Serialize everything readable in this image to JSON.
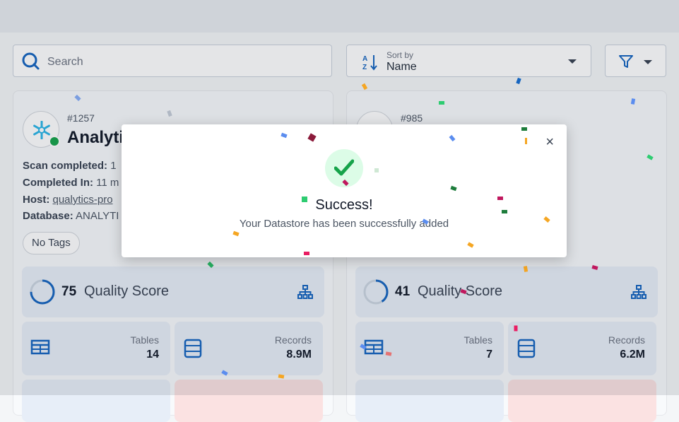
{
  "search": {
    "placeholder": "Search"
  },
  "sort": {
    "label": "Sort by",
    "value": "Name"
  },
  "cards": [
    {
      "id": "#1257",
      "name": "Analytics",
      "meta": [
        {
          "key": "Scan completed:",
          "value": "1"
        },
        {
          "key": "Completed In:",
          "value": "11 m"
        },
        {
          "key": "Host:",
          "value": "qualytics-pro"
        },
        {
          "key": "Database:",
          "value": "ANALYTI"
        }
      ],
      "tag": "No Tags",
      "quality_score": "75",
      "quality_fraction": 0.75,
      "quality_label": "Quality Score",
      "tables_label": "Tables",
      "tables_value": "14",
      "records_label": "Records",
      "records_value": "8.9M"
    },
    {
      "id": "#985",
      "quality_score": "41",
      "quality_fraction": 0.41,
      "quality_label": "Quality Score",
      "tables_label": "Tables",
      "tables_value": "7",
      "records_label": "Records",
      "records_value": "6.2M"
    }
  ],
  "modal": {
    "title": "Success!",
    "message": "Your Datastore has been successfully added",
    "close": "×"
  },
  "colors": {
    "accent": "#1565c0",
    "status_ok": "#16a34a",
    "success_check": "#16a34a"
  }
}
